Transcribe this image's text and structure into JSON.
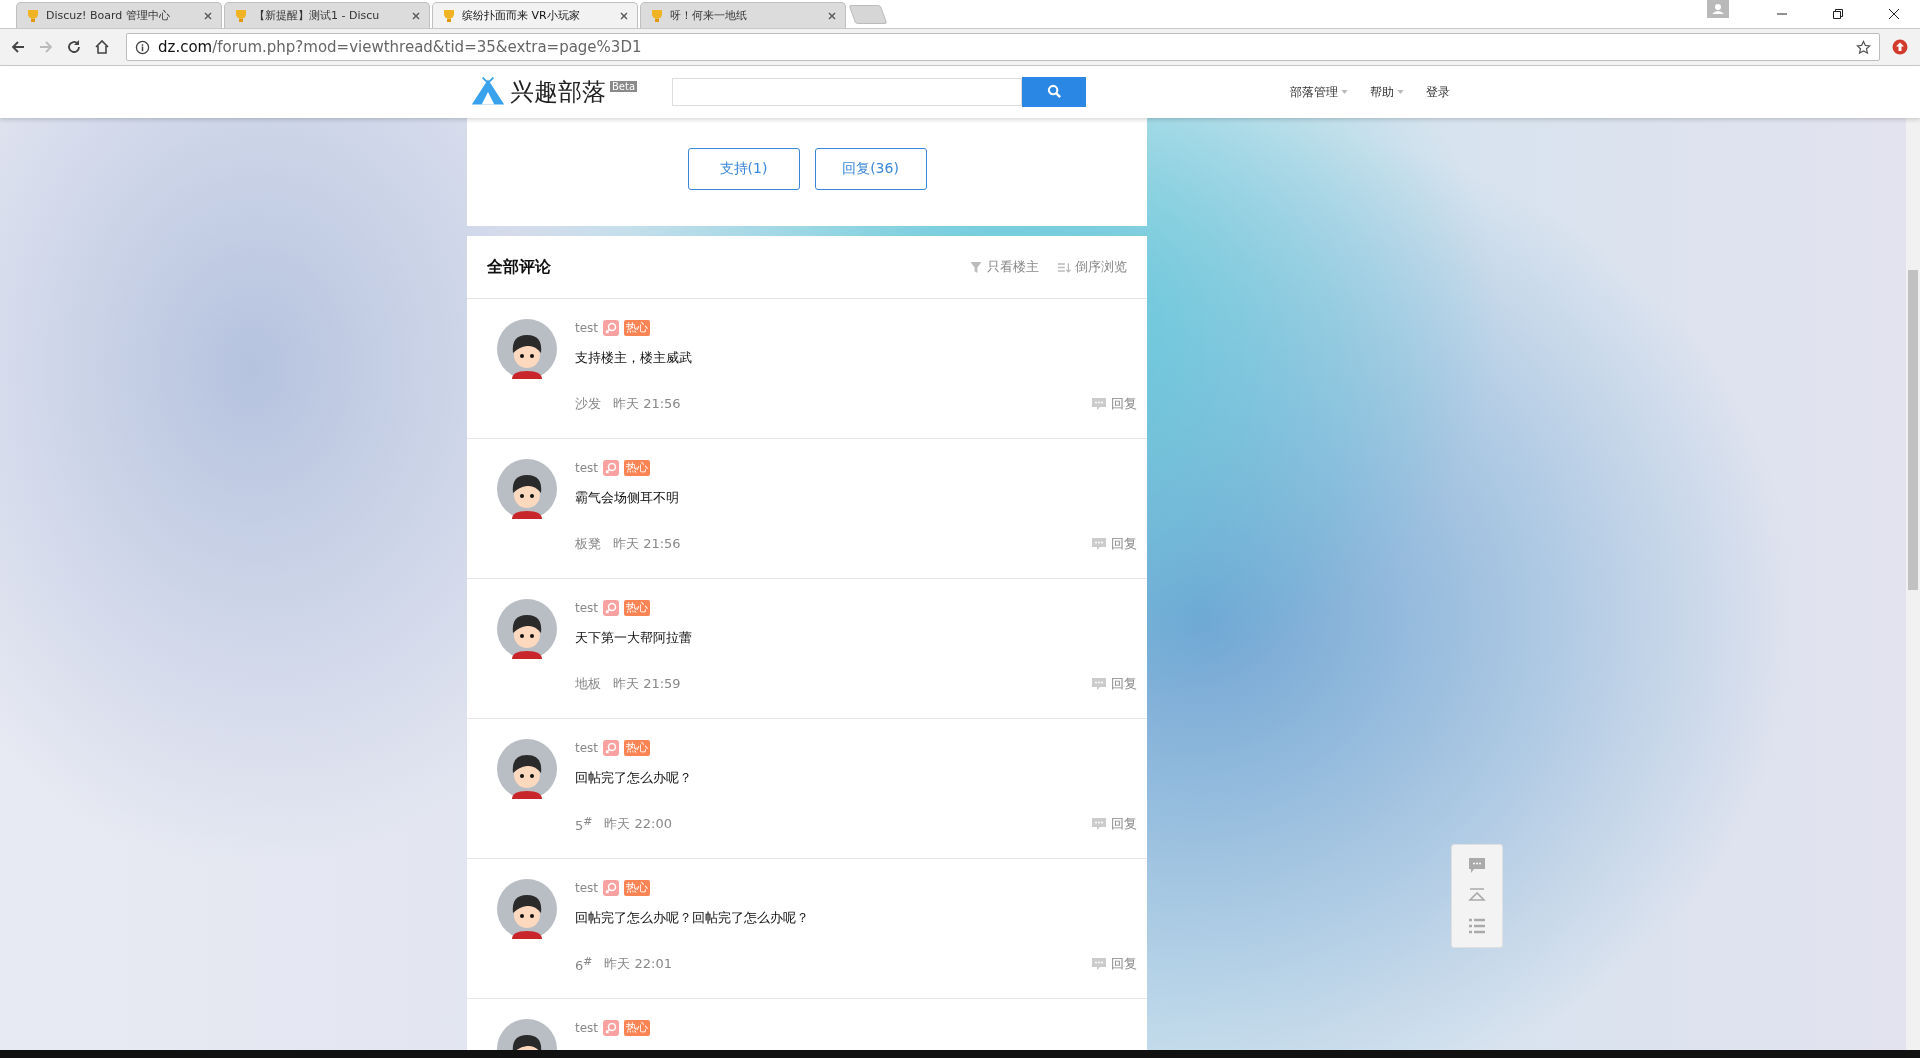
{
  "browser": {
    "tabs": [
      {
        "title": "Discuz! Board 管理中心",
        "selected": false
      },
      {
        "title": "【新提醒】测试1 - Discu",
        "selected": false
      },
      {
        "title": "缤纷扑面而来 VR小玩家",
        "selected": true
      },
      {
        "title": "呀！何来一地纸",
        "selected": false
      }
    ],
    "url": {
      "host": "dz.com",
      "path": "/forum.php?mod=viewthread&tid=35&extra=page%3D1"
    }
  },
  "site_header": {
    "logo": "兴趣部落",
    "logo_badge": "Beta",
    "nav": [
      {
        "label": "部落管理",
        "dropdown": true
      },
      {
        "label": "帮助",
        "dropdown": true
      },
      {
        "label": "登录",
        "dropdown": false
      }
    ]
  },
  "actions": [
    "支持(1)",
    "回复(36)"
  ],
  "comments_panel": {
    "title": "全部评论",
    "tools": [
      {
        "kind": "filter",
        "label": "只看楼主"
      },
      {
        "kind": "sort",
        "label": "倒序浏览"
      }
    ],
    "comments": [
      {
        "user": "test",
        "badge": "热心",
        "content": "支持楼主，楼主威武",
        "floor": "沙发",
        "time": "昨天 21:56",
        "reply": "回复"
      },
      {
        "user": "test",
        "badge": "热心",
        "content": "霸气会场侧耳不明",
        "floor": "板凳",
        "time": "昨天 21:56",
        "reply": "回复"
      },
      {
        "user": "test",
        "badge": "热心",
        "content": "天下第一大帮阿拉蕾",
        "floor": "地板",
        "time": "昨天 21:59",
        "reply": "回复"
      },
      {
        "user": "test",
        "badge": "热心",
        "content": "回帖完了怎么办呢？",
        "floor": "5$^{#}$",
        "time": "昨天 22:00",
        "reply": "回复"
      },
      {
        "user": "test",
        "badge": "热心",
        "content": "回帖完了怎么办呢？回帖完了怎么办呢？",
        "floor": "6$^{#}$",
        "time": "昨天 22:01",
        "reply": "回复"
      },
      {
        "user": "test",
        "badge": "热心"
      }
    ]
  }
}
